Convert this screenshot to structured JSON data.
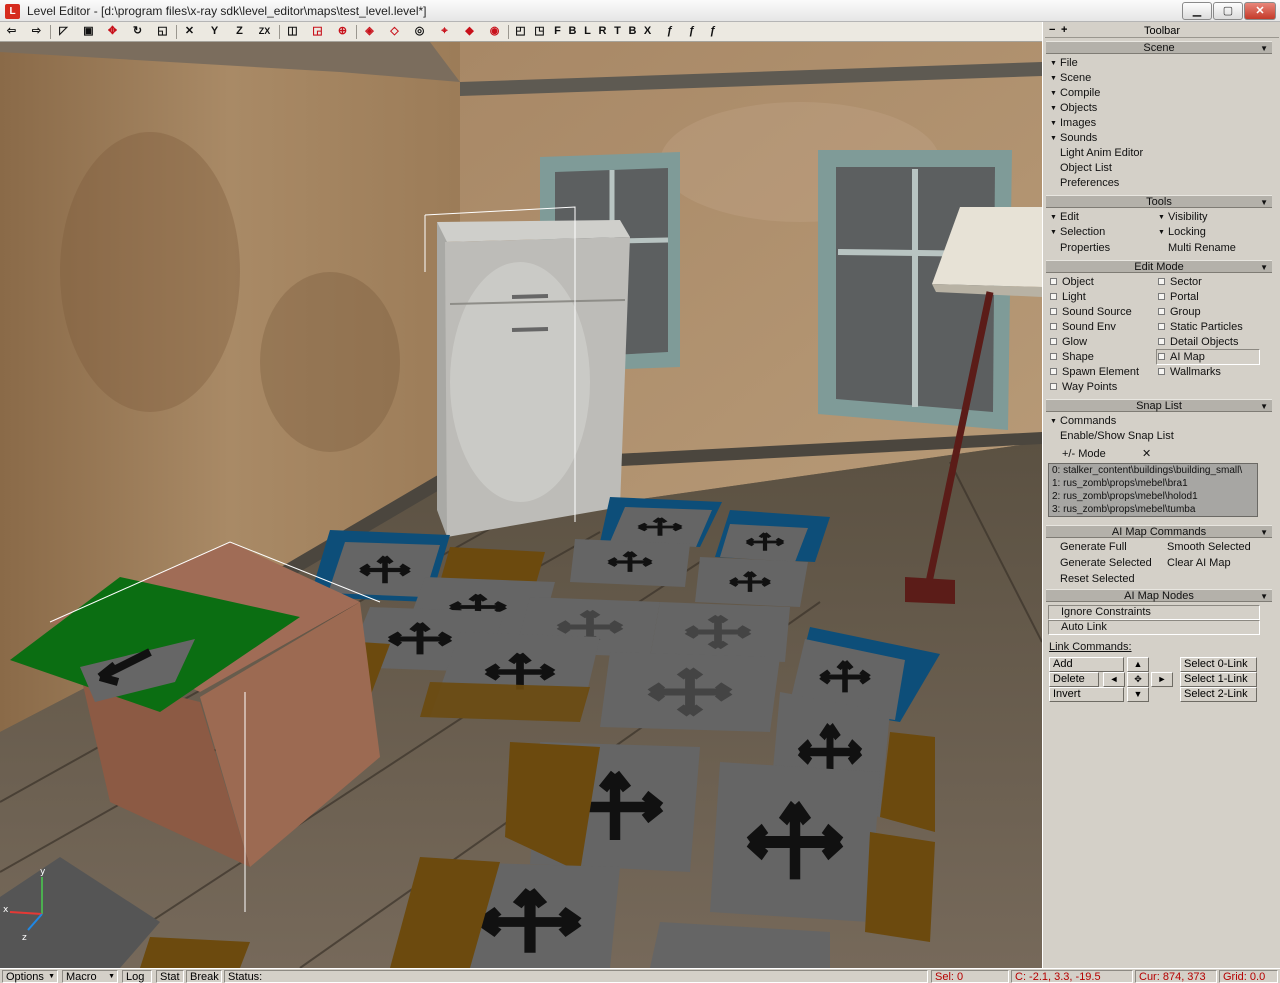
{
  "window": {
    "app_icon": "L",
    "title": "Level Editor - [d:\\program files\\x-ray sdk\\level_editor\\maps\\test_level.level*]",
    "min_glyph": "▁",
    "max_glyph": "▢",
    "close_glyph": "✕"
  },
  "toolbar": {
    "letters": [
      "Y",
      "Z",
      "ZX",
      "F",
      "B",
      "L",
      "R",
      "T",
      "B",
      "X"
    ]
  },
  "panel": {
    "minus": "−",
    "plus": "+",
    "title": "Toolbar",
    "scene": {
      "header": "Scene",
      "items": [
        "File",
        "Scene",
        "Compile",
        "Objects",
        "Images",
        "Sounds"
      ],
      "plain_items": [
        "Light Anim Editor",
        "Object List",
        "Preferences"
      ]
    },
    "tools": {
      "header": "Tools",
      "edit": "Edit",
      "selection": "Selection",
      "properties": "Properties",
      "visibility": "Visibility",
      "locking": "Locking",
      "multi_rename": "Multi Rename"
    },
    "edit_mode": {
      "header": "Edit Mode",
      "left": [
        "Object",
        "Light",
        "Sound Source",
        "Sound Env",
        "Glow",
        "Shape",
        "Spawn Element",
        "Way Points"
      ],
      "right": [
        "Sector",
        "Portal",
        "Group",
        "Static Particles",
        "Detail Objects",
        "AI Map",
        "Wallmarks"
      ]
    },
    "snap_list": {
      "header": "Snap List",
      "commands": "Commands",
      "enable_show": "Enable/Show Snap List",
      "mode_label": "+/- Mode",
      "mode_x": "✕",
      "entries": [
        "0: stalker_content\\buildings\\building_small\\",
        "1: rus_zomb\\props\\mebel\\bra1",
        "2: rus_zomb\\props\\mebel\\holod1",
        "3: rus_zomb\\props\\mebel\\tumba"
      ]
    },
    "ai_commands": {
      "header": "AI Map Commands",
      "generate_full": "Generate Full",
      "smooth_selected": "Smooth Selected",
      "generate_selected": "Generate Selected",
      "clear_ai_map": "Clear AI Map",
      "reset_selected": "Reset Selected"
    },
    "ai_nodes": {
      "header": "AI Map Nodes",
      "ignore_constraints": "Ignore Constraints",
      "auto_link": "Auto Link",
      "link_commands": "Link Commands:",
      "add": "Add",
      "delete": "Delete",
      "invert": "Invert",
      "select0": "Select 0-Link",
      "select1": "Select 1-Link",
      "select2": "Select 2-Link",
      "arrow_up": "▲",
      "arrow_left": "◄",
      "arrow_center": "✥",
      "arrow_right": "►",
      "arrow_down": "▼"
    }
  },
  "status": {
    "options": "Options",
    "macro": "Macro",
    "log": "Log",
    "stat": "Stat",
    "break": "Break",
    "status": "Status:",
    "sel": "Sel: 0",
    "coords": "C: -2.1, 3.3, -19.5",
    "cur": "Cur: 874, 373",
    "grid": "Grid: 0.0",
    "dropdown_glyph": "▼"
  },
  "viewport": {
    "axis_labels": [
      "y",
      "x",
      "z"
    ]
  }
}
